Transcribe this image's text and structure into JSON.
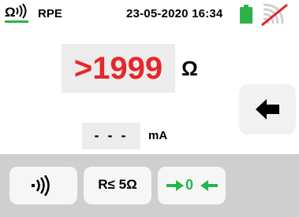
{
  "header": {
    "mode_label": "RPE",
    "datetime": "23-05-2020 16:34",
    "mode_icon": "ohm-continuity-icon",
    "battery_icon": "battery-full-icon",
    "signal_icon": "wireless-off-icon"
  },
  "main": {
    "value": ">1999",
    "unit": "Ω",
    "current_value": "- - -",
    "current_unit": "mA"
  },
  "side": {
    "back_icon": "arrow-left-icon"
  },
  "soft_keys": {
    "buzzer_icon": "buzzer-sound-icon",
    "limit_label": "R≤ 5Ω",
    "zero_label": "0"
  },
  "colors": {
    "value_red": "#e8252a",
    "battery_green": "#2bb34a",
    "zero_green": "#2bb34a",
    "signal_red": "#e0252a",
    "bottom_bar": "#cfcfcf"
  }
}
